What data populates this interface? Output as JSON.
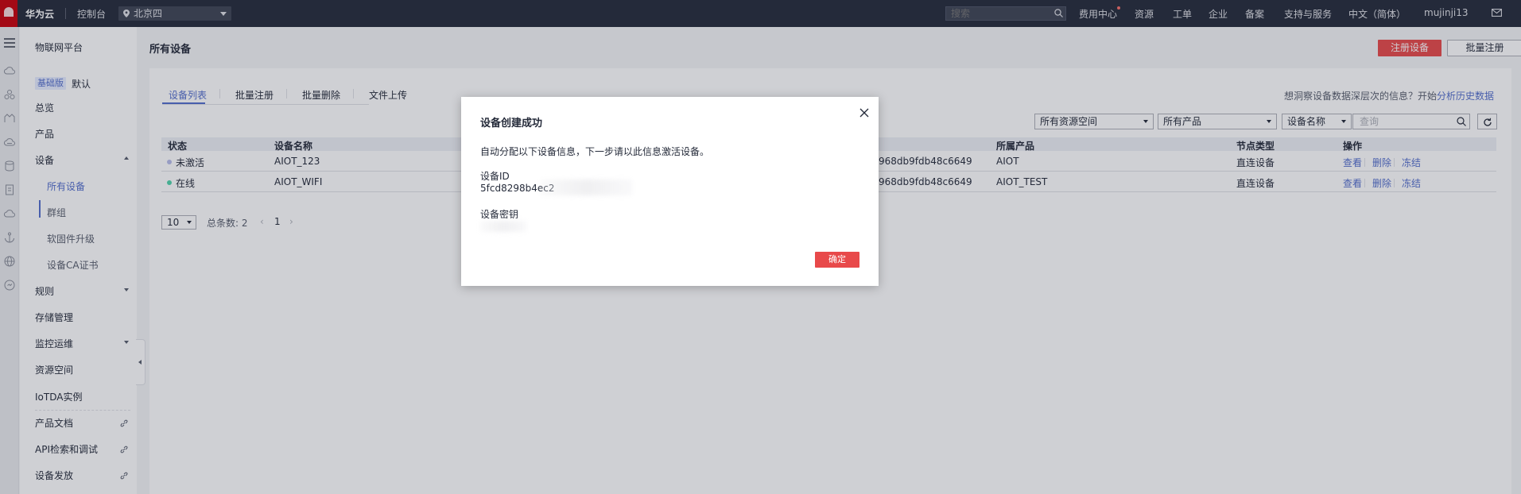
{
  "topbar": {
    "brand": "华为云",
    "console": "控制台",
    "region": "北京四",
    "search_placeholder": "搜索",
    "nav": [
      "费用中心",
      "资源",
      "工单",
      "企业",
      "备案",
      "支持与服务",
      "中文（简体）",
      "mujinji13"
    ]
  },
  "sidebar": {
    "title": "物联网平台",
    "edition_badge": "基础版",
    "edition_default": "默认",
    "items": {
      "overview": "总览",
      "product": "产品",
      "device": "设备",
      "all_devices": "所有设备",
      "group": "群组",
      "firmware": "软固件升级",
      "device_ca": "设备CA证书",
      "rules": "规则",
      "storage": "存储管理",
      "monitor": "监控运维",
      "resource_space": "资源空间",
      "iotda_instance": "IoTDA实例",
      "product_docs": "产品文档",
      "api_explorer": "API检索和调试",
      "device_provision": "设备发放"
    }
  },
  "main": {
    "page_title": "所有设备",
    "register_button": "注册设备",
    "batch_register_button": "批量注册",
    "tabs": [
      "设备列表",
      "批量注册",
      "批量删除",
      "文件上传"
    ],
    "insight_text": "想洞察设备数据深层次的信息？开始",
    "insight_link": "分析历史数据",
    "filters": {
      "resource_space": "所有资源空间",
      "product": "所有产品",
      "field": "设备名称",
      "query_placeholder": "查询"
    },
    "table": {
      "headers": [
        "状态",
        "设备名称",
        "所属产品",
        "节点类型",
        "操作"
      ],
      "rows": [
        {
          "status": "未激活",
          "name": "AIOT_123",
          "id_tail": "968db9fdb48c6649",
          "product": "AIOT",
          "node_type": "直连设备"
        },
        {
          "status": "在线",
          "name": "AIOT_WIFI",
          "id_tail": "968db9fdb48c6649",
          "product": "AIOT_TEST",
          "node_type": "直连设备"
        }
      ],
      "actions": [
        "查看",
        "删除",
        "冻结"
      ]
    },
    "pagination": {
      "page_size": "10",
      "total": "总条数: 2",
      "page": "1",
      "prev": "‹",
      "next": "›"
    }
  },
  "dialog": {
    "title": "设备创建成功",
    "description": "自动分配以下设备信息，下一步请以此信息激活设备。",
    "device_id_label": "设备ID",
    "device_id_value": "5fcd8298b4ec2",
    "secret_label": "设备密钥",
    "ok_button": "确定"
  },
  "colors": {
    "topbar": "#252b3a",
    "primary_button": "#e8494a",
    "link": "#526ecc",
    "status_inactive": "#b8bdea",
    "status_online": "#50d4ab"
  }
}
